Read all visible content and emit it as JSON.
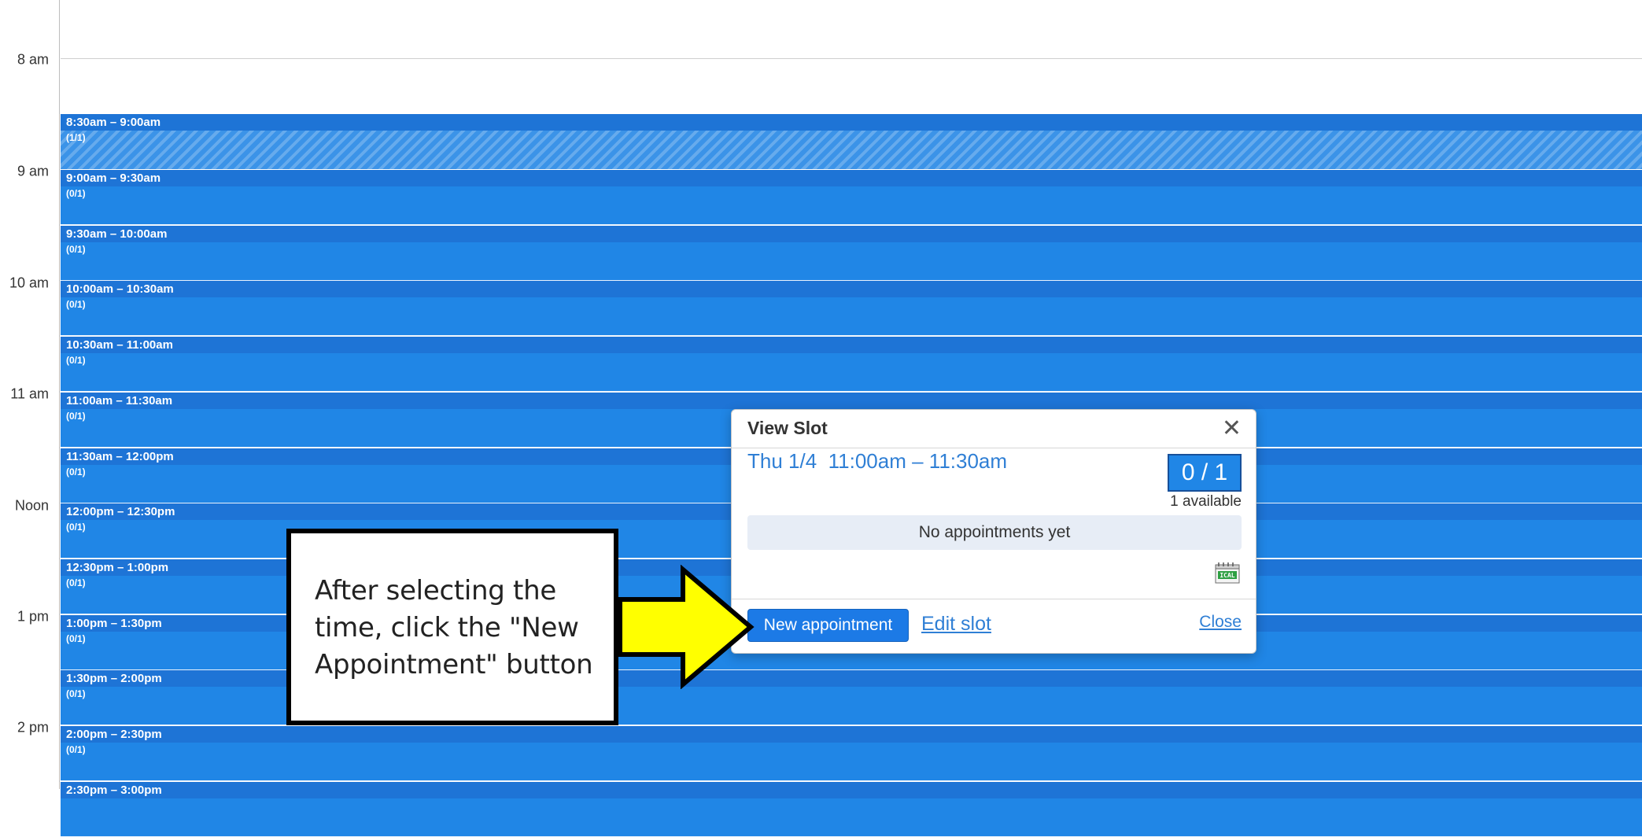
{
  "hours": [
    "8 am",
    "9 am",
    "10 am",
    "11 am",
    "Noon",
    "1 pm",
    "2 pm"
  ],
  "slots": [
    {
      "time": "8:30am – 9:00am",
      "count": "(1/1)"
    },
    {
      "time": "9:00am – 9:30am",
      "count": "(0/1)"
    },
    {
      "time": "9:30am – 10:00am",
      "count": "(0/1)"
    },
    {
      "time": "10:00am – 10:30am",
      "count": "(0/1)"
    },
    {
      "time": "10:30am – 11:00am",
      "count": "(0/1)"
    },
    {
      "time": "11:00am – 11:30am",
      "count": "(0/1)"
    },
    {
      "time": "11:30am – 12:00pm",
      "count": "(0/1)"
    },
    {
      "time": "12:00pm – 12:30pm",
      "count": "(0/1)"
    },
    {
      "time": "12:30pm – 1:00pm",
      "count": "(0/1)"
    },
    {
      "time": "1:00pm – 1:30pm",
      "count": "(0/1)"
    },
    {
      "time": "1:30pm – 2:00pm",
      "count": "(0/1)"
    },
    {
      "time": "2:00pm – 2:30pm",
      "count": "(0/1)"
    },
    {
      "time": "2:30pm – 3:00pm",
      "count": ""
    }
  ],
  "popup": {
    "title": "View Slot",
    "close_x": "✕",
    "date": "Thu 1/4",
    "time_range": "11:00am – 11:30am",
    "count": "0 / 1",
    "available": "1 available",
    "empty_message": "No appointments yet",
    "ical_label": "ICAL",
    "new_appointment_label": "New appointment",
    "edit_slot_label": "Edit slot",
    "close_label": "Close"
  },
  "callout": {
    "text": "After selecting the time, click the \"New Appointment\" button"
  },
  "colors": {
    "slot_blue": "#2086e6",
    "slot_header_blue": "#1e74d6",
    "link_blue": "#2f7fd5",
    "arrow_yellow": "#ffff00"
  },
  "icons": {
    "close": "close-icon",
    "calendar_export": "ical-icon",
    "callout_arrow": "arrow-right-icon"
  }
}
